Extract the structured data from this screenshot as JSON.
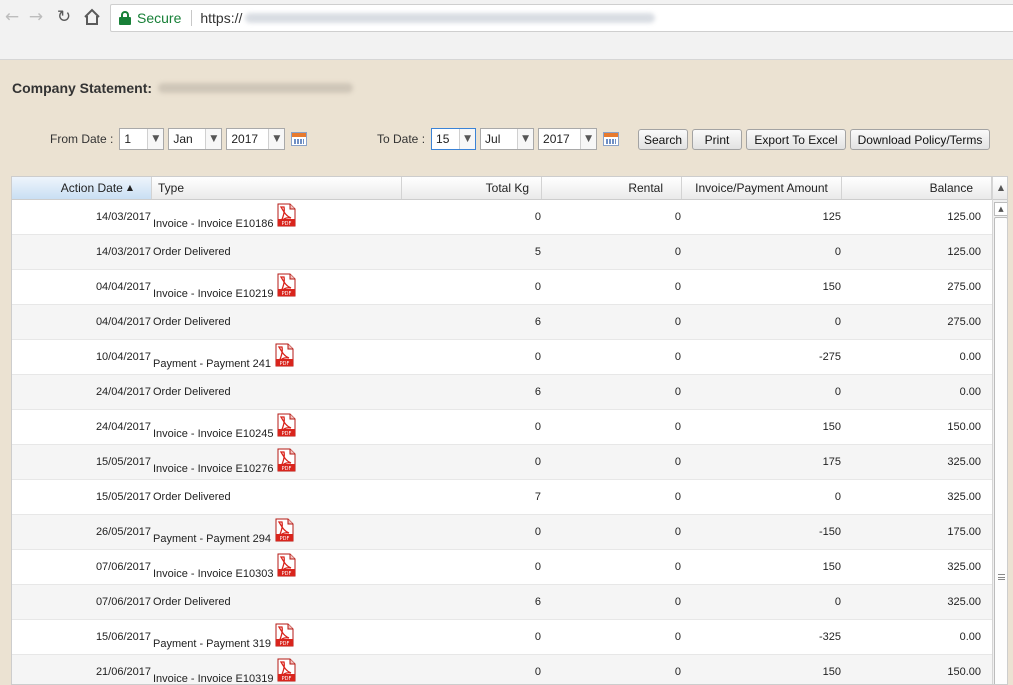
{
  "browser": {
    "secure_label": "Secure",
    "url_scheme": "https://"
  },
  "page": {
    "title": "Company Statement:"
  },
  "filters": {
    "from_label": "From Date :",
    "from_day": "1",
    "from_month": "Jan",
    "from_year": "2017",
    "to_label": "To Date :",
    "to_day": "15",
    "to_month": "Jul",
    "to_year": "2017"
  },
  "buttons": {
    "search": "Search",
    "print": "Print",
    "export": "Export To Excel",
    "download": "Download Policy/Terms"
  },
  "grid": {
    "columns": [
      "Action Date",
      "Type",
      "Total Kg",
      "Rental",
      "Invoice/Payment Amount",
      "Balance"
    ],
    "rows": [
      {
        "date": "14/03/2017",
        "type": "Invoice - Invoice E10186",
        "pdf": true,
        "kg": "0",
        "rental": "0",
        "amount": "125",
        "balance": "125.00"
      },
      {
        "date": "14/03/2017",
        "type": "Order Delivered",
        "pdf": false,
        "kg": "5",
        "rental": "0",
        "amount": "0",
        "balance": "125.00"
      },
      {
        "date": "04/04/2017",
        "type": "Invoice - Invoice E10219",
        "pdf": true,
        "kg": "0",
        "rental": "0",
        "amount": "150",
        "balance": "275.00"
      },
      {
        "date": "04/04/2017",
        "type": "Order Delivered",
        "pdf": false,
        "kg": "6",
        "rental": "0",
        "amount": "0",
        "balance": "275.00"
      },
      {
        "date": "10/04/2017",
        "type": "Payment - Payment 241",
        "pdf": true,
        "kg": "0",
        "rental": "0",
        "amount": "-275",
        "balance": "0.00"
      },
      {
        "date": "24/04/2017",
        "type": "Order Delivered",
        "pdf": false,
        "kg": "6",
        "rental": "0",
        "amount": "0",
        "balance": "0.00"
      },
      {
        "date": "24/04/2017",
        "type": "Invoice - Invoice E10245",
        "pdf": true,
        "kg": "0",
        "rental": "0",
        "amount": "150",
        "balance": "150.00"
      },
      {
        "date": "15/05/2017",
        "type": "Invoice - Invoice E10276",
        "pdf": true,
        "kg": "0",
        "rental": "0",
        "amount": "175",
        "balance": "325.00"
      },
      {
        "date": "15/05/2017",
        "type": "Order Delivered",
        "pdf": false,
        "kg": "7",
        "rental": "0",
        "amount": "0",
        "balance": "325.00"
      },
      {
        "date": "26/05/2017",
        "type": "Payment - Payment 294",
        "pdf": true,
        "kg": "0",
        "rental": "0",
        "amount": "-150",
        "balance": "175.00"
      },
      {
        "date": "07/06/2017",
        "type": "Invoice - Invoice E10303",
        "pdf": true,
        "kg": "0",
        "rental": "0",
        "amount": "150",
        "balance": "325.00"
      },
      {
        "date": "07/06/2017",
        "type": "Order Delivered",
        "pdf": false,
        "kg": "6",
        "rental": "0",
        "amount": "0",
        "balance": "325.00"
      },
      {
        "date": "15/06/2017",
        "type": "Payment - Payment 319",
        "pdf": true,
        "kg": "0",
        "rental": "0",
        "amount": "-325",
        "balance": "0.00"
      },
      {
        "date": "21/06/2017",
        "type": "Invoice - Invoice E10319",
        "pdf": true,
        "kg": "0",
        "rental": "0",
        "amount": "150",
        "balance": "150.00"
      }
    ]
  },
  "icons": {
    "pdf": "pdf-icon",
    "calendar": "calendar-icon",
    "lock": "lock-icon"
  },
  "colors": {
    "page_bg": "#ebe2d2",
    "secure_green": "#188038",
    "pdf_red": "#d9241c"
  }
}
